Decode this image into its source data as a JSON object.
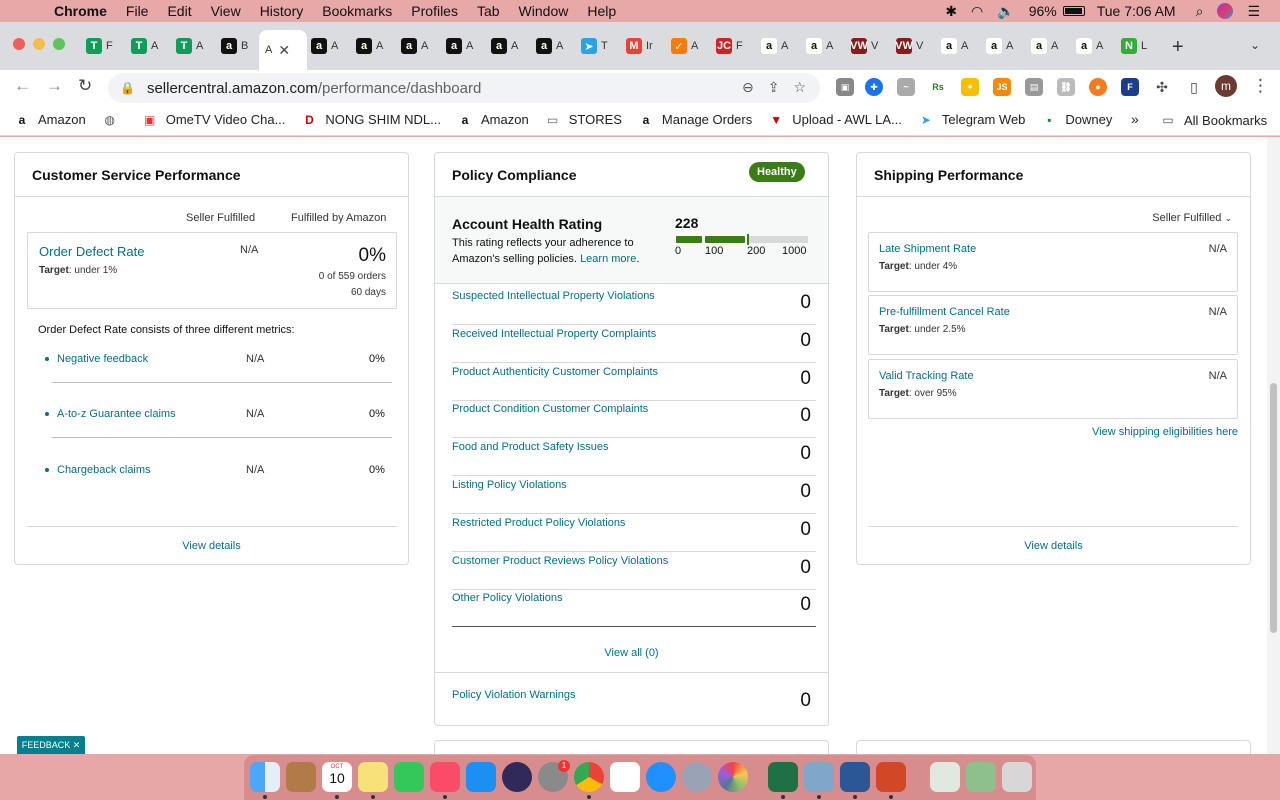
{
  "menubar": {
    "items": [
      "Chrome",
      "File",
      "Edit",
      "View",
      "History",
      "Bookmarks",
      "Profiles",
      "Tab",
      "Window",
      "Help"
    ],
    "battery": "96%",
    "clock": "Tue 7:06 AM"
  },
  "tabs": [
    {
      "fav": "T",
      "label": "F",
      "color": "#0f9d58"
    },
    {
      "fav": "T",
      "label": "A",
      "color": "#0f9d58"
    },
    {
      "fav": "T",
      "label": "A",
      "color": "#0f9d58"
    },
    {
      "fav": "a",
      "label": "B",
      "color": "#111111"
    },
    {
      "fav": "a",
      "label": "A",
      "color": "#111111"
    },
    {
      "fav": "a",
      "label": "A",
      "color": "#111111"
    },
    {
      "fav": "a",
      "label": "A",
      "color": "#111111"
    },
    {
      "fav": "a",
      "label": "A",
      "color": "#111111"
    },
    {
      "fav": "a",
      "label": "A",
      "color": "#111111"
    },
    {
      "fav": "a",
      "label": "A",
      "color": "#111111"
    },
    {
      "fav": "➤",
      "label": "T",
      "color": "#2aa3e0"
    },
    {
      "fav": "M",
      "label": "Ir",
      "color": "#ea4335"
    },
    {
      "fav": "✓",
      "label": "A",
      "color": "#ff7a00"
    },
    {
      "fav": "JC",
      "label": "F",
      "color": "#d42020"
    },
    {
      "fav": "a",
      "label": "A",
      "color": "#ffffff"
    },
    {
      "fav": "a",
      "label": "A",
      "color": "#ffffff"
    },
    {
      "fav": "VW",
      "label": "V",
      "color": "#8b1a1a"
    },
    {
      "fav": "VW",
      "label": "V",
      "color": "#8b1a1a"
    },
    {
      "fav": "a",
      "label": "A",
      "color": "#ffffff"
    },
    {
      "fav": "a",
      "label": "A",
      "color": "#ffffff"
    },
    {
      "fav": "a",
      "label": "A",
      "color": "#ffffff"
    },
    {
      "fav": "a",
      "label": "A",
      "color": "#ffffff"
    },
    {
      "fav": "N",
      "label": "L",
      "color": "#2fae3a"
    }
  ],
  "active_tab": {
    "label": "A",
    "close": "✕"
  },
  "omnibox": {
    "host": "sellercentral.amazon.com",
    "path": "/performance/dashboard"
  },
  "profile_initial": "m",
  "bookmarks": [
    {
      "icon": "a",
      "label": "Amazon"
    },
    {
      "icon": "◍",
      "label": ""
    },
    {
      "icon": "▣",
      "label": "OmeTV Video Cha..."
    },
    {
      "icon": "D",
      "label": "NONG SHIM NDL..."
    },
    {
      "icon": "a",
      "label": "Amazon"
    },
    {
      "icon": "▭",
      "label": "STORES"
    },
    {
      "icon": "a",
      "label": "Manage Orders"
    },
    {
      "icon": "▼",
      "label": "Upload - AWL LA..."
    },
    {
      "icon": "➤",
      "label": "Telegram Web"
    },
    {
      "icon": "▪",
      "label": "Downey"
    }
  ],
  "bookmarks_more": "»",
  "all_bookmarks": "All Bookmarks",
  "customer_service": {
    "title": "Customer Service Performance",
    "col_seller": "Seller Fulfilled",
    "col_fba": "Fulfilled by Amazon",
    "odr_label": "Order Defect Rate",
    "odr_target_prefix": "Target",
    "odr_target": ": under 1%",
    "odr_seller": "N/A",
    "odr_fba": "0%",
    "odr_orders": "0 of 559 orders",
    "odr_days": "60 days",
    "consists_text": "Order Defect Rate consists of three different metrics:",
    "metrics": [
      {
        "label": "Negative feedback",
        "seller": "N/A",
        "fba": "0%"
      },
      {
        "label": "A-to-z Guarantee claims",
        "seller": "N/A",
        "fba": "0%"
      },
      {
        "label": "Chargeback claims",
        "seller": "N/A",
        "fba": "0%"
      }
    ],
    "view_details": "View details"
  },
  "policy": {
    "title": "Policy Compliance",
    "badge": "Healthy",
    "ahr_title": "Account Health Rating",
    "ahr_desc_1": "This rating reflects your adherence to",
    "ahr_desc_2": "Amazon's selling policies.",
    "learn_more": "Learn more",
    "period": ".",
    "score": "228",
    "score_value": 228,
    "scale": [
      "0",
      "100",
      "200",
      "1000"
    ],
    "rows": [
      {
        "label": "Suspected Intellectual Property Violations",
        "value": "0"
      },
      {
        "label": "Received Intellectual Property Complaints",
        "value": "0"
      },
      {
        "label": "Product Authenticity Customer Complaints",
        "value": "0"
      },
      {
        "label": "Product Condition Customer Complaints",
        "value": "0"
      },
      {
        "label": "Food and Product Safety Issues",
        "value": "0"
      },
      {
        "label": "Listing Policy Violations",
        "value": "0"
      },
      {
        "label": "Restricted Product Policy Violations",
        "value": "0"
      },
      {
        "label": "Customer Product Reviews Policy Violations",
        "value": "0"
      },
      {
        "label": "Other Policy Violations",
        "value": "0"
      }
    ],
    "view_all": "View all (0)",
    "warnings_label": "Policy Violation Warnings",
    "warnings_value": "0",
    "colors": {
      "healthy": "#3a7d16",
      "bar_empty": "#d5d9d9"
    }
  },
  "shipping": {
    "title": "Shipping Performance",
    "dropdown": "Seller Fulfilled",
    "metrics": [
      {
        "label": "Late Shipment Rate",
        "target": ": under 4%",
        "value": "N/A"
      },
      {
        "label": "Pre-fulfillment Cancel Rate",
        "target": ": under 2.5%",
        "value": "N/A"
      },
      {
        "label": "Valid Tracking Rate",
        "target": ": over 95%",
        "value": "N/A"
      }
    ],
    "target_prefix": "Target",
    "eligibilities_link": "View shipping eligibilities here",
    "view_details": "View details"
  },
  "feedback_label": "FEEDBACK ✕",
  "dock_date": {
    "month": "OCT",
    "day": "10"
  },
  "dock_badge": "1"
}
